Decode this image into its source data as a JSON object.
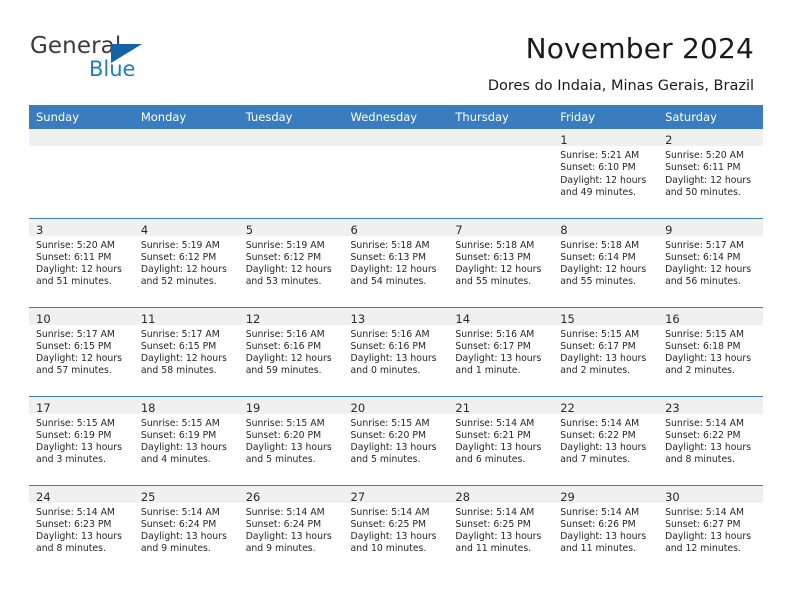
{
  "brand": {
    "name_part1": "General",
    "name_part2": "Blue",
    "accent_color": "#1f7fc4",
    "triangle_color": "#1263a8"
  },
  "header": {
    "title": "November 2024",
    "subtitle": "Dores do Indaia, Minas Gerais, Brazil",
    "header_band_color": "#3a7dbf"
  },
  "weekdays": [
    "Sunday",
    "Monday",
    "Tuesday",
    "Wednesday",
    "Thursday",
    "Friday",
    "Saturday"
  ],
  "weeks": [
    [
      {
        "day": "",
        "lines": []
      },
      {
        "day": "",
        "lines": []
      },
      {
        "day": "",
        "lines": []
      },
      {
        "day": "",
        "lines": []
      },
      {
        "day": "",
        "lines": []
      },
      {
        "day": "1",
        "lines": [
          "Sunrise: 5:21 AM",
          "Sunset: 6:10 PM",
          "Daylight: 12 hours",
          "and 49 minutes."
        ]
      },
      {
        "day": "2",
        "lines": [
          "Sunrise: 5:20 AM",
          "Sunset: 6:11 PM",
          "Daylight: 12 hours",
          "and 50 minutes."
        ]
      }
    ],
    [
      {
        "day": "3",
        "lines": [
          "Sunrise: 5:20 AM",
          "Sunset: 6:11 PM",
          "Daylight: 12 hours",
          "and 51 minutes."
        ]
      },
      {
        "day": "4",
        "lines": [
          "Sunrise: 5:19 AM",
          "Sunset: 6:12 PM",
          "Daylight: 12 hours",
          "and 52 minutes."
        ]
      },
      {
        "day": "5",
        "lines": [
          "Sunrise: 5:19 AM",
          "Sunset: 6:12 PM",
          "Daylight: 12 hours",
          "and 53 minutes."
        ]
      },
      {
        "day": "6",
        "lines": [
          "Sunrise: 5:18 AM",
          "Sunset: 6:13 PM",
          "Daylight: 12 hours",
          "and 54 minutes."
        ]
      },
      {
        "day": "7",
        "lines": [
          "Sunrise: 5:18 AM",
          "Sunset: 6:13 PM",
          "Daylight: 12 hours",
          "and 55 minutes."
        ]
      },
      {
        "day": "8",
        "lines": [
          "Sunrise: 5:18 AM",
          "Sunset: 6:14 PM",
          "Daylight: 12 hours",
          "and 55 minutes."
        ]
      },
      {
        "day": "9",
        "lines": [
          "Sunrise: 5:17 AM",
          "Sunset: 6:14 PM",
          "Daylight: 12 hours",
          "and 56 minutes."
        ]
      }
    ],
    [
      {
        "day": "10",
        "lines": [
          "Sunrise: 5:17 AM",
          "Sunset: 6:15 PM",
          "Daylight: 12 hours",
          "and 57 minutes."
        ]
      },
      {
        "day": "11",
        "lines": [
          "Sunrise: 5:17 AM",
          "Sunset: 6:15 PM",
          "Daylight: 12 hours",
          "and 58 minutes."
        ]
      },
      {
        "day": "12",
        "lines": [
          "Sunrise: 5:16 AM",
          "Sunset: 6:16 PM",
          "Daylight: 12 hours",
          "and 59 minutes."
        ]
      },
      {
        "day": "13",
        "lines": [
          "Sunrise: 5:16 AM",
          "Sunset: 6:16 PM",
          "Daylight: 13 hours",
          "and 0 minutes."
        ]
      },
      {
        "day": "14",
        "lines": [
          "Sunrise: 5:16 AM",
          "Sunset: 6:17 PM",
          "Daylight: 13 hours",
          "and 1 minute."
        ]
      },
      {
        "day": "15",
        "lines": [
          "Sunrise: 5:15 AM",
          "Sunset: 6:17 PM",
          "Daylight: 13 hours",
          "and 2 minutes."
        ]
      },
      {
        "day": "16",
        "lines": [
          "Sunrise: 5:15 AM",
          "Sunset: 6:18 PM",
          "Daylight: 13 hours",
          "and 2 minutes."
        ]
      }
    ],
    [
      {
        "day": "17",
        "lines": [
          "Sunrise: 5:15 AM",
          "Sunset: 6:19 PM",
          "Daylight: 13 hours",
          "and 3 minutes."
        ]
      },
      {
        "day": "18",
        "lines": [
          "Sunrise: 5:15 AM",
          "Sunset: 6:19 PM",
          "Daylight: 13 hours",
          "and 4 minutes."
        ]
      },
      {
        "day": "19",
        "lines": [
          "Sunrise: 5:15 AM",
          "Sunset: 6:20 PM",
          "Daylight: 13 hours",
          "and 5 minutes."
        ]
      },
      {
        "day": "20",
        "lines": [
          "Sunrise: 5:15 AM",
          "Sunset: 6:20 PM",
          "Daylight: 13 hours",
          "and 5 minutes."
        ]
      },
      {
        "day": "21",
        "lines": [
          "Sunrise: 5:14 AM",
          "Sunset: 6:21 PM",
          "Daylight: 13 hours",
          "and 6 minutes."
        ]
      },
      {
        "day": "22",
        "lines": [
          "Sunrise: 5:14 AM",
          "Sunset: 6:22 PM",
          "Daylight: 13 hours",
          "and 7 minutes."
        ]
      },
      {
        "day": "23",
        "lines": [
          "Sunrise: 5:14 AM",
          "Sunset: 6:22 PM",
          "Daylight: 13 hours",
          "and 8 minutes."
        ]
      }
    ],
    [
      {
        "day": "24",
        "lines": [
          "Sunrise: 5:14 AM",
          "Sunset: 6:23 PM",
          "Daylight: 13 hours",
          "and 8 minutes."
        ]
      },
      {
        "day": "25",
        "lines": [
          "Sunrise: 5:14 AM",
          "Sunset: 6:24 PM",
          "Daylight: 13 hours",
          "and 9 minutes."
        ]
      },
      {
        "day": "26",
        "lines": [
          "Sunrise: 5:14 AM",
          "Sunset: 6:24 PM",
          "Daylight: 13 hours",
          "and 9 minutes."
        ]
      },
      {
        "day": "27",
        "lines": [
          "Sunrise: 5:14 AM",
          "Sunset: 6:25 PM",
          "Daylight: 13 hours",
          "and 10 minutes."
        ]
      },
      {
        "day": "28",
        "lines": [
          "Sunrise: 5:14 AM",
          "Sunset: 6:25 PM",
          "Daylight: 13 hours",
          "and 11 minutes."
        ]
      },
      {
        "day": "29",
        "lines": [
          "Sunrise: 5:14 AM",
          "Sunset: 6:26 PM",
          "Daylight: 13 hours",
          "and 11 minutes."
        ]
      },
      {
        "day": "30",
        "lines": [
          "Sunrise: 5:14 AM",
          "Sunset: 6:27 PM",
          "Daylight: 13 hours",
          "and 12 minutes."
        ]
      }
    ]
  ]
}
